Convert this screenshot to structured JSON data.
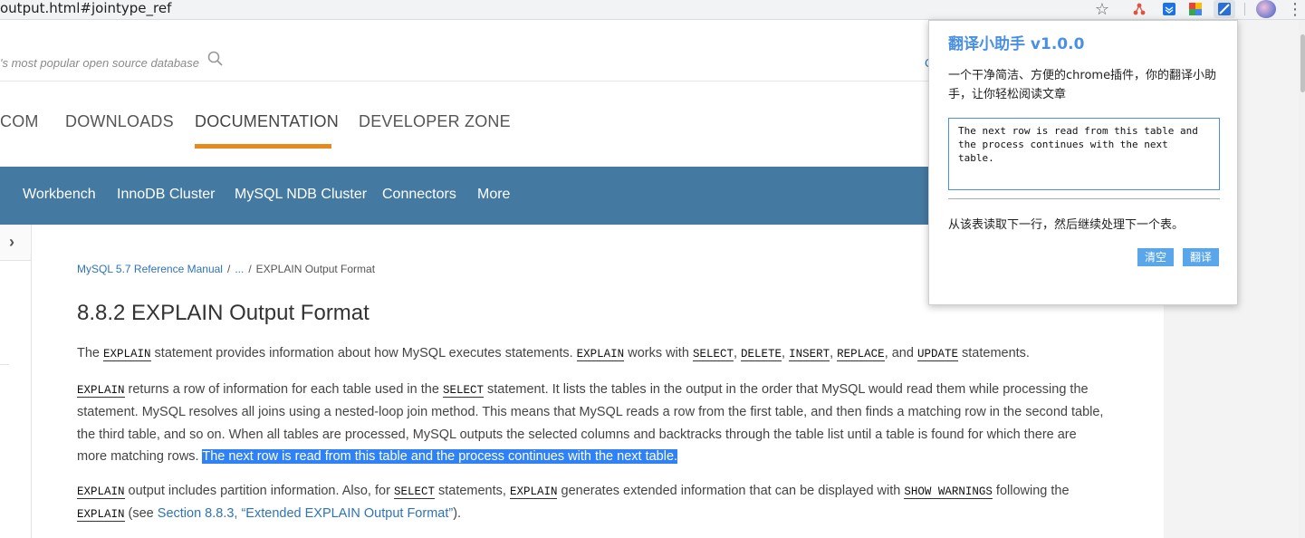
{
  "browser": {
    "url": "output.html#jointype_ref",
    "star_icon": "star-icon",
    "menu_icon": "kebab-menu-icon"
  },
  "header": {
    "tagline": "'s most popular open source database",
    "partial_right_link": "C"
  },
  "main_nav": {
    "items": [
      "COM",
      "DOWNLOADS",
      "DOCUMENTATION",
      "DEVELOPER ZONE"
    ],
    "active": "DOCUMENTATION",
    "accent_color": "#e68a1e"
  },
  "product_nav": {
    "items": [
      "Workbench",
      "InnoDB Cluster",
      "MySQL NDB Cluster",
      "Connectors",
      "More"
    ],
    "bg_color": "#4479a1"
  },
  "sidebar": {
    "toggle_glyph": "›"
  },
  "breadcrumb": {
    "manual": "MySQL 5.7 Reference Manual",
    "ellipsis": "...",
    "current": "EXPLAIN Output Format",
    "separator": "/"
  },
  "content": {
    "title": "8.8.2 EXPLAIN Output Format",
    "p1": {
      "t1": "The ",
      "c1": "EXPLAIN",
      "t2": " statement provides information about how MySQL executes statements. ",
      "c2": "EXPLAIN",
      "t3": " works with ",
      "c3": "SELECT",
      "t4": ", ",
      "c4": "DELETE",
      "t5": ", ",
      "c5": "INSERT",
      "t6": ", ",
      "c6": "REPLACE",
      "t7": ", and ",
      "c7": "UPDATE",
      "t8": " statements."
    },
    "p2": {
      "c1": "EXPLAIN",
      "t1": " returns a row of information for each table used in the ",
      "c2": "SELECT",
      "t2": " statement. It lists the tables in the output in the order that MySQL would read them while processing the statement. MySQL resolves all joins using a nested-loop join method. This means that MySQL reads a row from the first table, and then finds a matching row in the second table, the third table, and so on. When all tables are processed, MySQL outputs the selected columns and backtracks through the table list until a table is found for which there are more matching rows. ",
      "highlight": "The next row is read from this table and the process continues with the next table."
    },
    "p3": {
      "c1": "EXPLAIN",
      "t1": " output includes partition information. Also, for ",
      "c2": "SELECT",
      "t2": " statements, ",
      "c3": "EXPLAIN",
      "t3": " generates extended information that can be displayed with ",
      "c4": "SHOW WARNINGS",
      "t4": " following the ",
      "c5": "EXPLAIN",
      "t5": " (see ",
      "link": "Section 8.8.3, “Extended EXPLAIN Output Format”",
      "t6": ")."
    }
  },
  "translator_popup": {
    "title": "翻译小助手 v1.0.0",
    "description": "一个干净简洁、方便的chrome插件，你的翻译小助手，让你轻松阅读文章",
    "input_value": "The next row is read from this table and the process continues with the next table.",
    "result": "从该表读取下一行，然后继续处理下一个表。",
    "clear_label": "清空",
    "translate_label": "翻译",
    "accent_color": "#4a90e2"
  }
}
